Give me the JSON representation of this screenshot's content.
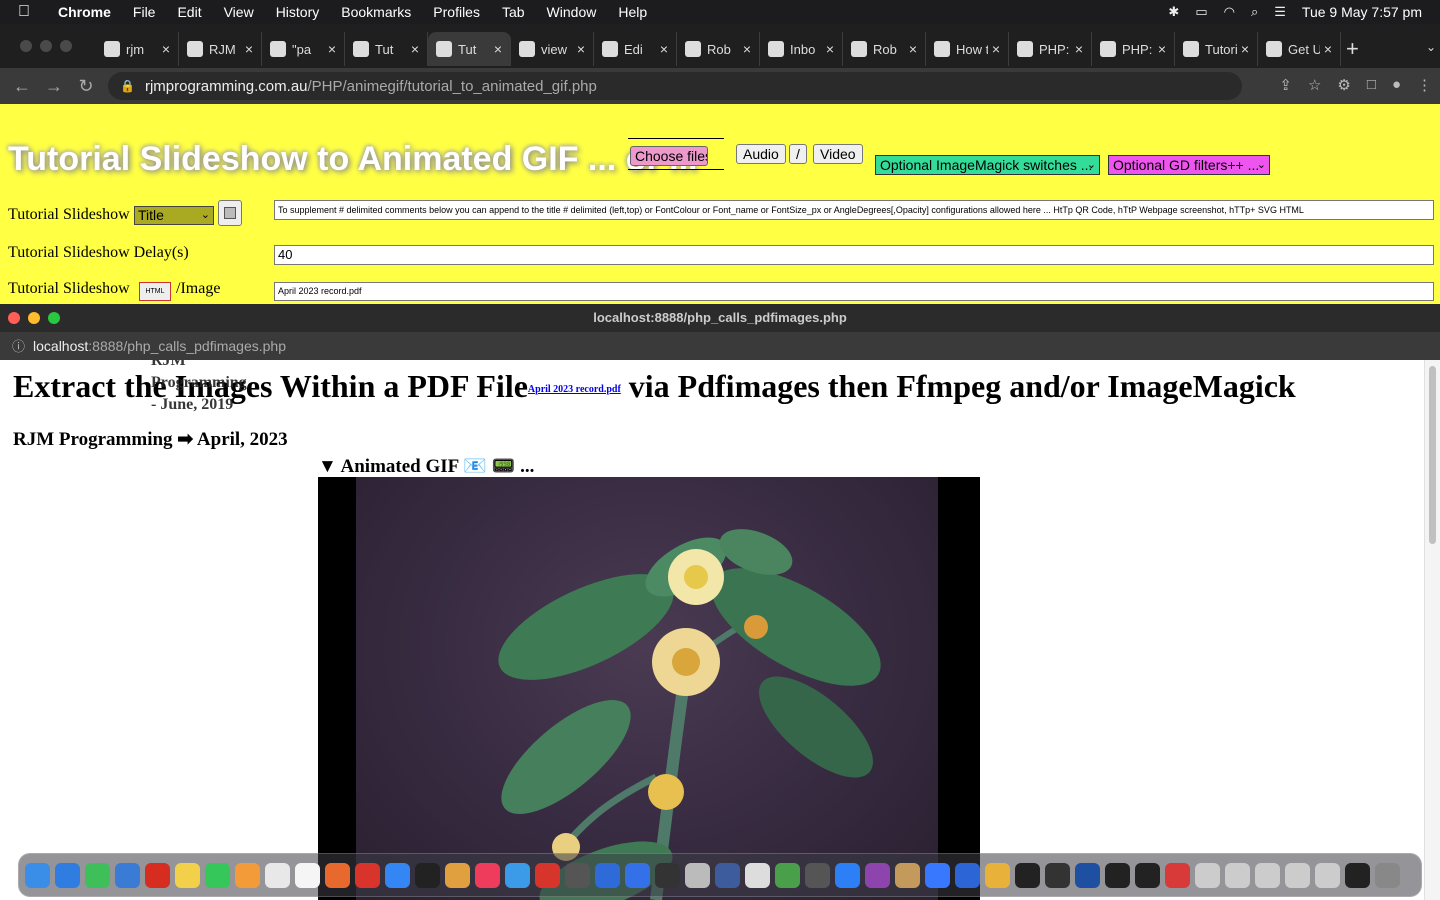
{
  "menubar": {
    "apple": "",
    "app_name": "Chrome",
    "menus": [
      "File",
      "Edit",
      "View",
      "History",
      "Bookmarks",
      "Profiles",
      "Tab",
      "Window",
      "Help"
    ],
    "clock": "Tue 9 May  7:57 pm"
  },
  "tabs": [
    {
      "label": "rjm"
    },
    {
      "label": "RJM"
    },
    {
      "label": "\"pa"
    },
    {
      "label": "Tut"
    },
    {
      "label": "Tut"
    },
    {
      "label": "view"
    },
    {
      "label": "Edi"
    },
    {
      "label": "Rob"
    },
    {
      "label": "Inbo"
    },
    {
      "label": "Rob"
    },
    {
      "label": "How to"
    },
    {
      "label": "PHP: re"
    },
    {
      "label": "PHP: $_"
    },
    {
      "label": "Tutorial"
    },
    {
      "label": "Get UR"
    }
  ],
  "omnibox": {
    "host": "rjmprogramming.com.au",
    "path": "/PHP/animegif/tutorial_to_animated_gif.php"
  },
  "page": {
    "title": "Tutorial Slideshow to Animated GIF ... or ...",
    "choose_files": "Choose files",
    "audio_button": "Audio",
    "slash_button": "/",
    "video_button": "Video",
    "imagemagick_select": "Optional ImageMagick switches ...",
    "gd_select": "Optional GD filters++ ...",
    "row1_label": "Tutorial Slideshow",
    "row1_select": "Title",
    "row1_field": "To supplement # delimited comments below you can append to the title # delimited (left,top) or FontColour or Font_name or FontSize_px or AngleDegrees[,Opacity] configurations allowed here ... HtTp QR Code, hTtP Webpage screenshot, hTTp+ SVG HTML",
    "row2_label": "Tutorial Slideshow Delay(s)",
    "row2_field": "40",
    "row3_label": "Tutorial Slideshow",
    "row3_html_icon": "HTML",
    "row3_suffix": "/Image",
    "row3_field": "April 2023 record.pdf"
  },
  "popup": {
    "window_title": "localhost:8888/php_calls_pdfimages.php",
    "addr_host": "localhost",
    "addr_path": ":8888/php_calls_pdfimages.php",
    "h1_before": "Extract the Images Within a PDF File",
    "h1_link": "April 2023 record.pdf",
    "h1_after": " via Pdfimages then Ffmpeg and/or ImageMagick",
    "overlay_line1": "RJM",
    "overlay_line2": "Programming",
    "overlay_line3": "- June, 2019",
    "h2": "RJM Programming ➡ April, 2023",
    "summary": "▼ Animated GIF 📧 📟 ..."
  },
  "colors": {
    "page_yellow": "#ffff44",
    "chrome_dark": "#1f1f1f",
    "imagemagick_select": "#33dd99",
    "gd_select": "#ee55ee",
    "choose_files": "#ee99cc"
  }
}
